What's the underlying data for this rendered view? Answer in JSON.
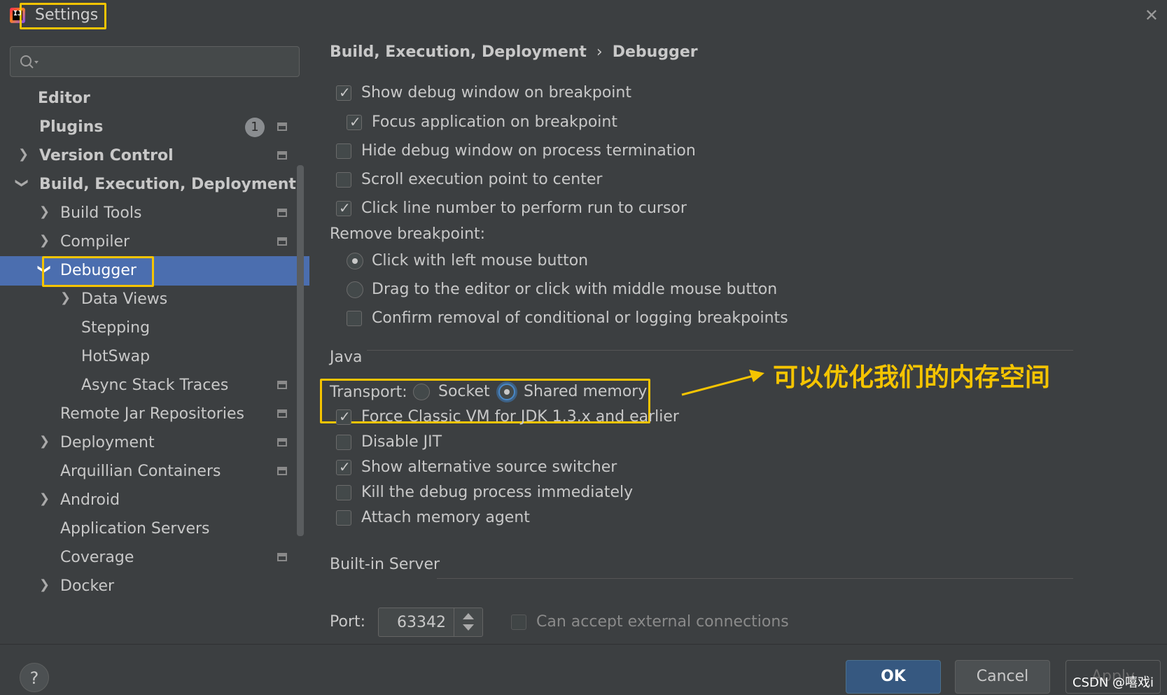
{
  "window": {
    "title": "Settings"
  },
  "sidebar": {
    "search_placeholder": "",
    "items": [
      {
        "label": "Editor"
      },
      {
        "label": "Plugins",
        "badge": "1"
      },
      {
        "label": "Version Control"
      },
      {
        "label": "Build, Execution, Deployment"
      },
      {
        "label": "Build Tools"
      },
      {
        "label": "Compiler"
      },
      {
        "label": "Debugger"
      },
      {
        "label": "Data Views"
      },
      {
        "label": "Stepping"
      },
      {
        "label": "HotSwap"
      },
      {
        "label": "Async Stack Traces"
      },
      {
        "label": "Remote Jar Repositories"
      },
      {
        "label": "Deployment"
      },
      {
        "label": "Arquillian Containers"
      },
      {
        "label": "Android"
      },
      {
        "label": "Application Servers"
      },
      {
        "label": "Coverage"
      },
      {
        "label": "Docker"
      }
    ]
  },
  "breadcrumb": {
    "parent": "Build, Execution, Deployment",
    "separator": "›",
    "current": "Debugger"
  },
  "options": {
    "show_debug_window": {
      "label": "Show debug window on breakpoint",
      "checked": true
    },
    "focus_application": {
      "label": "Focus application on breakpoint",
      "checked": true
    },
    "hide_debug_window": {
      "label": "Hide debug window on process termination",
      "checked": false
    },
    "scroll_execution": {
      "label": "Scroll execution point to center",
      "checked": false
    },
    "click_line_number": {
      "label": "Click line number to perform run to cursor",
      "checked": true
    }
  },
  "remove_breakpoint": {
    "label": "Remove breakpoint:",
    "click_left": "Click with left mouse button",
    "drag_editor": "Drag to the editor or click with middle mouse button",
    "confirm_removal": "Confirm removal of conditional or logging breakpoints"
  },
  "java": {
    "section": "Java",
    "transport_label": "Transport:",
    "socket": "Socket",
    "shared_memory": "Shared memory",
    "force_classic": "Force Classic VM for JDK 1.3.x and earlier",
    "disable_jit": "Disable JIT",
    "show_alt_source": "Show alternative source switcher",
    "kill_debug": "Kill the debug process immediately",
    "attach_memory": "Attach memory agent"
  },
  "builtin_server": {
    "section": "Built-in Server",
    "port_label": "Port:",
    "port_value": "63342",
    "external_connections": "Can accept external connections"
  },
  "annotation": {
    "text": "可以优化我们的内存空间",
    "color": "#f5c400"
  },
  "footer": {
    "help": "?",
    "ok": "OK",
    "cancel": "Cancel",
    "apply": "Apply",
    "watermark": "CSDN @嘻戏i"
  },
  "colors": {
    "accent": "#4b6eaf",
    "background": "#3c3f41",
    "highlight": "#f5c400"
  }
}
